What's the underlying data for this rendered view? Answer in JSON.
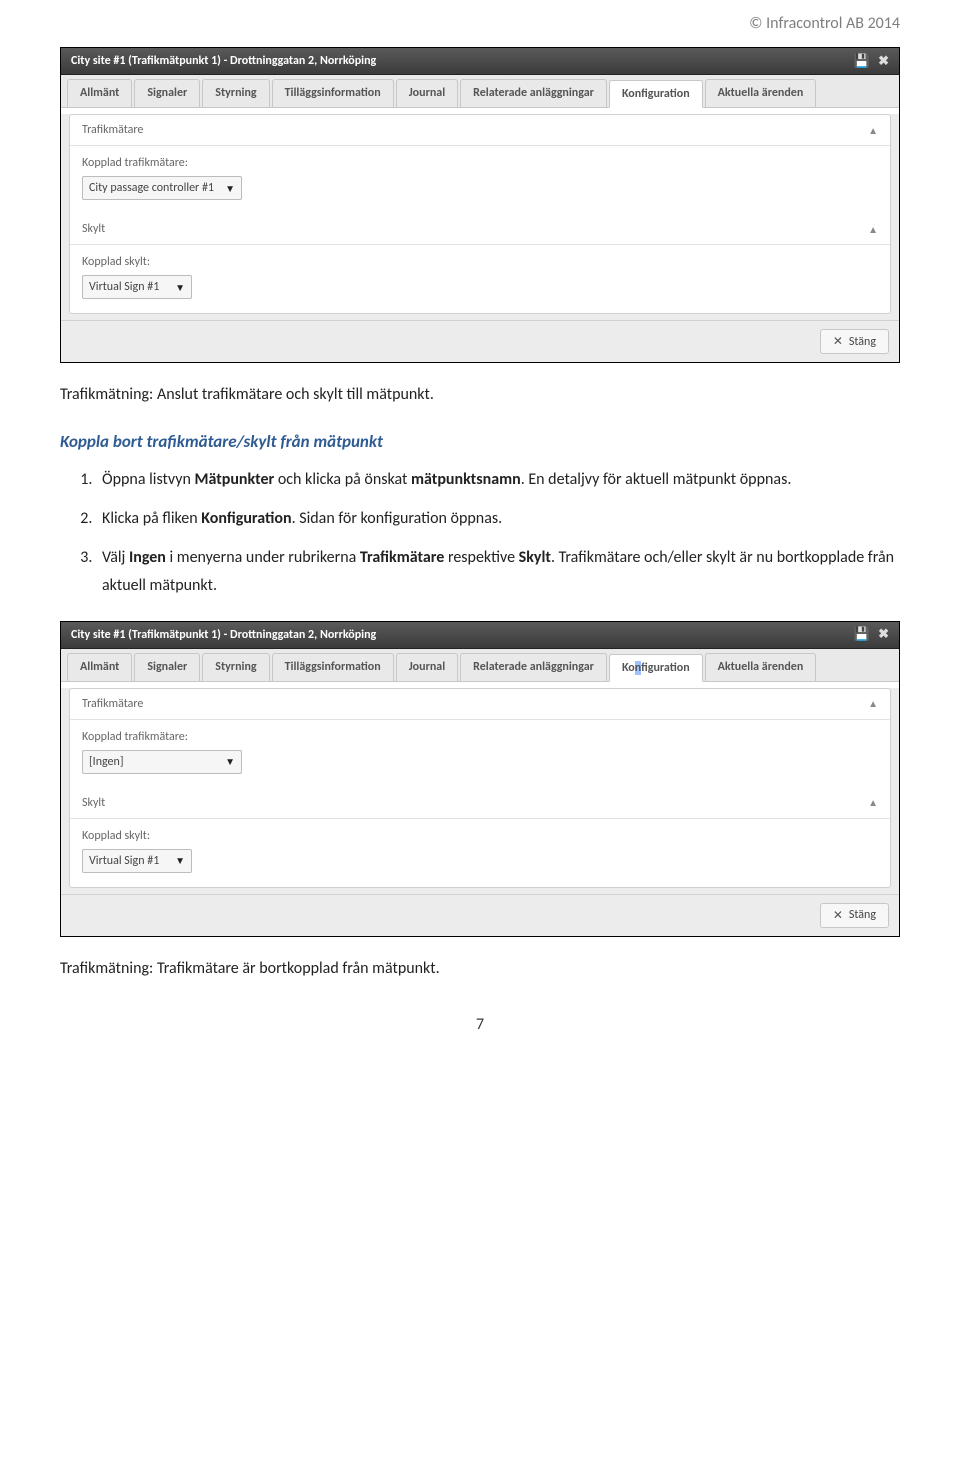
{
  "header": {
    "copyright": "© Infracontrol AB 2014"
  },
  "panel1": {
    "title": "City site #1 (Trafikmätpunkt 1) - Drottninggatan 2, Norrköping",
    "tabs": [
      "Allmänt",
      "Signaler",
      "Styrning",
      "Tilläggsinformation",
      "Journal",
      "Relaterade anläggningar",
      "Konfiguration",
      "Aktuella ärenden"
    ],
    "active_tab_index": 6,
    "sections": {
      "trafik": {
        "header": "Trafikmätare",
        "label": "Kopplad trafikmätare:",
        "select_value": "City passage controller #1"
      },
      "skylt": {
        "header": "Skylt",
        "label": "Kopplad skylt:",
        "select_value": "Virtual Sign #1"
      }
    },
    "close_btn": "Stäng"
  },
  "caption1": "Trafikmätning: Anslut trafikmätare och skylt till mätpunkt.",
  "subheading": "Koppla bort trafikmätare/skylt från mätpunkt",
  "steps": {
    "1a": "Öppna listvyn ",
    "1b": "Mätpunkter",
    "1c": " och klicka på önskat ",
    "1d": "mätpunktsnamn",
    "1e": ". En detaljvy för aktuell mätpunkt öppnas.",
    "2a": "Klicka på fliken ",
    "2b": "Konfiguration",
    "2c": ". Sidan för konfiguration öppnas.",
    "3a": "Välj ",
    "3b": "Ingen",
    "3c": " i menyerna under rubrikerna ",
    "3d": "Trafikmätare",
    "3e": " respektive ",
    "3f": "Skylt",
    "3g": ". Trafikmätare och/eller skylt är nu bortkopplade från aktuell mätpunkt."
  },
  "panel2": {
    "title": "City site #1 (Trafikmätpunkt 1) - Drottninggatan 2, Norrköping",
    "tabs": {
      "pre": "Ko",
      "hl": "n",
      "post": "figuration"
    },
    "tabs_full": [
      "Allmänt",
      "Signaler",
      "Styrning",
      "Tilläggsinformation",
      "Journal",
      "Relaterade anläggningar",
      "Konfiguration",
      "Aktuella ärenden"
    ],
    "active_tab_index": 6,
    "sections": {
      "trafik": {
        "header": "Trafikmätare",
        "label": "Kopplad trafikmätare:",
        "select_value": "[Ingen]"
      },
      "skylt": {
        "header": "Skylt",
        "label": "Kopplad skylt:",
        "select_value": "Virtual Sign #1"
      }
    },
    "close_btn": "Stäng"
  },
  "caption2": "Trafikmätning: Trafikmätare är bortkopplad från mätpunkt.",
  "page_number": "7"
}
